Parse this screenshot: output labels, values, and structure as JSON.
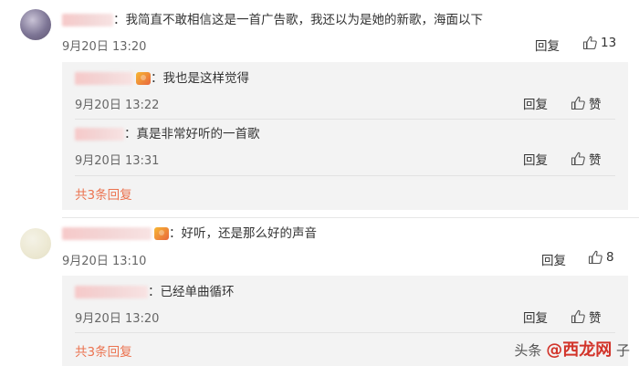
{
  "comments": [
    {
      "text": "：我简直不敢相信这是一首广告歌，我还以为是她的新歌，海面以下",
      "time": "9月20日 13:20",
      "reply_label": "回复",
      "like_count": "13",
      "replies": [
        {
          "text": "：我也是这样觉得",
          "time": "9月20日 13:22",
          "reply_label": "回复",
          "like_label": "赞"
        },
        {
          "text": "：真是非常好听的一首歌",
          "time": "9月20日 13:31",
          "reply_label": "回复",
          "like_label": "赞"
        }
      ],
      "more_replies": "共3条回复"
    },
    {
      "text": "：好听，还是那么好的声音",
      "time": "9月20日 13:10",
      "reply_label": "回复",
      "like_count": "8",
      "replies": [
        {
          "text": "：已经单曲循环",
          "time": "9月20日 13:20",
          "reply_label": "回复",
          "like_label": "赞"
        }
      ],
      "more_replies": "共3条回复"
    }
  ],
  "watermark": {
    "prefix": "头条",
    "brand": "@西龙网",
    "suffix": "子"
  },
  "colors": {
    "link": "#eb7350",
    "reply_bg": "#f3f3f3"
  }
}
